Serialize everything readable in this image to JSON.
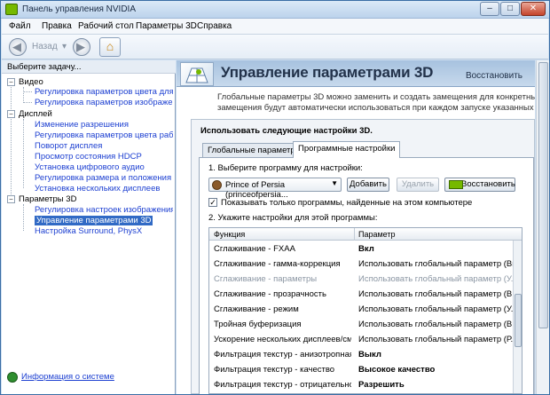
{
  "window": {
    "title": "Панель управления NVIDIA",
    "min": "–",
    "max": "□",
    "close": "✕"
  },
  "menu": [
    "Файл",
    "Правка",
    "Рабочий стол",
    "Параметры 3D",
    "Справка"
  ],
  "toolbar": {
    "back_label": "Назад",
    "back_arrow": "◀",
    "forward_arrow": "▶",
    "dropdown": "▾",
    "home_glyph": "⌂"
  },
  "sidebar": {
    "header": "Выберите задачу...",
    "groups": [
      {
        "label": "Видео",
        "items": [
          "Регулировка параметров цвета для вид",
          "Регулировка параметров изображения д"
        ]
      },
      {
        "label": "Дисплей",
        "items": [
          "Изменение разрешения",
          "Регулировка параметров цвета рабочег",
          "Поворот дисплея",
          "Просмотр состояния HDCP",
          "Установка цифрового аудио",
          "Регулировка размера и положения рабоч",
          "Установка нескольких дисплеев"
        ]
      },
      {
        "label": "Параметры 3D",
        "items": [
          "Регулировка настроек изображения с п",
          "Управление параметрами 3D",
          "Настройка Surround, PhysX"
        ]
      }
    ],
    "footer_link": "Информация о системе"
  },
  "main": {
    "title": "Управление параметрами 3D",
    "restore": "Восстановить",
    "intro_line1": "Глобальные параметры 3D можно заменить и создать замещения для конкретных програм",
    "intro_line2": "замещения будут автоматически использоваться при каждом запуске указанных программ",
    "panel_title": "Использовать следующие настройки 3D.",
    "tabs": [
      "Глобальные параметры",
      "Программные настройки"
    ],
    "step1": "1. Выберите программу для настройки:",
    "program": "Prince of Persia (princeofpersia...",
    "add": "Добавить",
    "remove": "Удалить",
    "restore_btn": "Восстановить",
    "checkbox_label": "Показывать только программы, найденные на этом компьютере",
    "checkbox_mark": "✓",
    "step2": "2. Укажите настройки для этой программы:",
    "columns": [
      "Функция",
      "Параметр"
    ],
    "rows": [
      {
        "f": "Сглаживание - FXAA",
        "p": "Вкл"
      },
      {
        "f": "Сглаживание - гамма-коррекция",
        "p": "Использовать глобальный параметр (Вкл)"
      },
      {
        "f": "Сглаживание - параметры",
        "p": "Использовать глобальный параметр (У..."
      },
      {
        "f": "Сглаживание - прозрачность",
        "p": "Использовать глобальный параметр (В..."
      },
      {
        "f": "Сглаживание - режим",
        "p": "Использовать глобальный параметр (У..."
      },
      {
        "f": "Тройная буферизация",
        "p": "Использовать глобальный параметр (В..."
      },
      {
        "f": "Ускорение нескольких дисплеев/смеша...",
        "p": "Использовать глобальный параметр (Р..."
      },
      {
        "f": "Фильтрация текстур - анизотропная оп...",
        "p": "Выкл"
      },
      {
        "f": "Фильтрация текстур - качество",
        "p": "Высокое качество"
      },
      {
        "f": "Фильтрация текстур - отрицательное о...",
        "p": "Разрешить"
      }
    ]
  }
}
